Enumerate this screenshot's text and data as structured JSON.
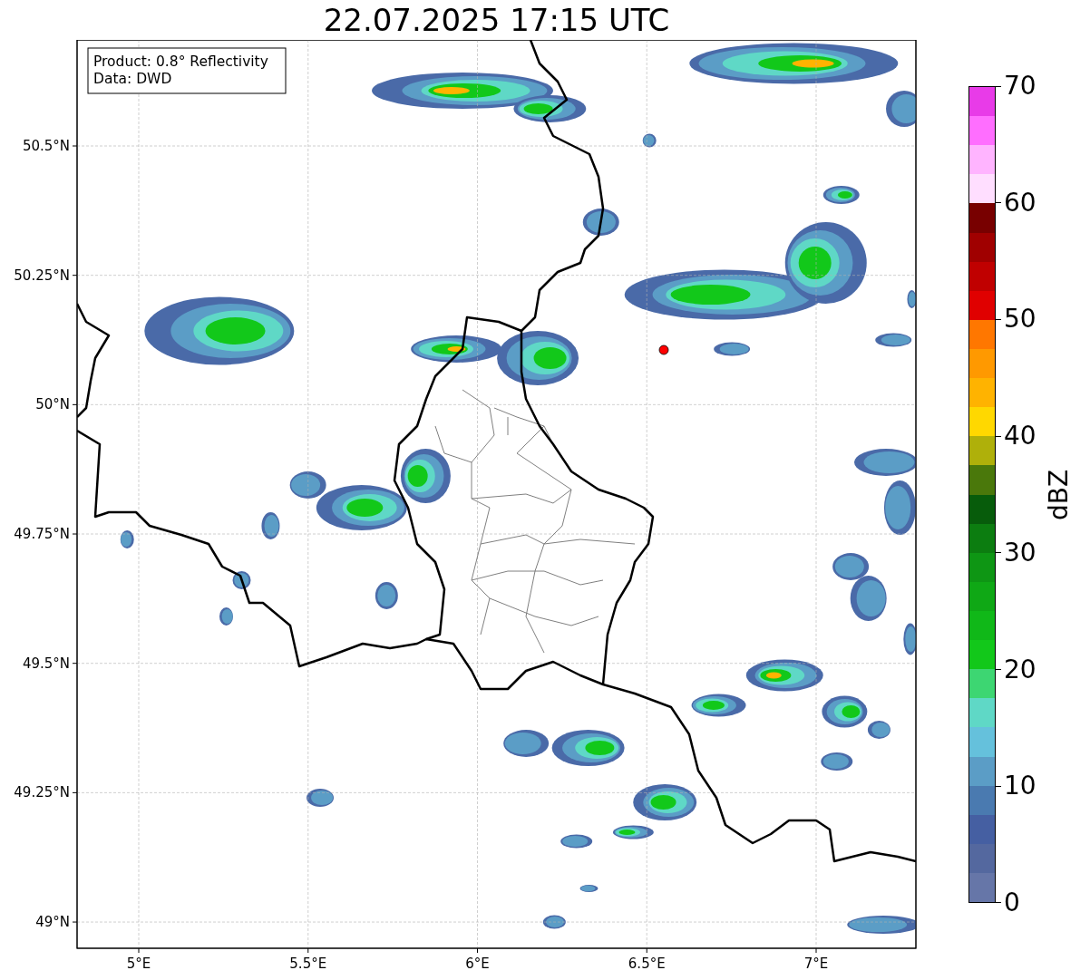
{
  "title": "22.07.2025 17:15 UTC",
  "annotation": [
    "Product: 0.8° Reflectivity",
    "Data: DWD"
  ],
  "xticks": [
    "5°E",
    "5.5°E",
    "6°E",
    "6.5°E",
    "7°E"
  ],
  "yticks": [
    "50.5°N",
    "50.25°N",
    "50°N",
    "49.75°N",
    "49.5°N",
    "49.25°N",
    "49°N"
  ],
  "colorbar": {
    "label": "dBZ",
    "ticks": [
      "70",
      "60",
      "50",
      "40",
      "30",
      "20",
      "10",
      "0"
    ],
    "segments": [
      {
        "color": "#e83be8"
      },
      {
        "color": "#ff6eff"
      },
      {
        "color": "#ffb4ff"
      },
      {
        "color": "#ffdeff"
      },
      {
        "color": "#780000"
      },
      {
        "color": "#a00000"
      },
      {
        "color": "#c00000"
      },
      {
        "color": "#e00000"
      },
      {
        "color": "#ff7700"
      },
      {
        "color": "#ff9900"
      },
      {
        "color": "#ffb300"
      },
      {
        "color": "#ffd800"
      },
      {
        "color": "#afb00a"
      },
      {
        "color": "#4a780b"
      },
      {
        "color": "#075c0b"
      },
      {
        "color": "#0c7d10"
      },
      {
        "color": "#0e9614"
      },
      {
        "color": "#0fa815"
      },
      {
        "color": "#10b818"
      },
      {
        "color": "#12c81a"
      },
      {
        "color": "#3dd672"
      },
      {
        "color": "#5fd8c6"
      },
      {
        "color": "#65c1dc"
      },
      {
        "color": "#5b9dc6"
      },
      {
        "color": "#4a7ab0"
      },
      {
        "color": "#455fa2"
      },
      {
        "color": "#54689f"
      },
      {
        "color": "#6676a8"
      }
    ]
  }
}
